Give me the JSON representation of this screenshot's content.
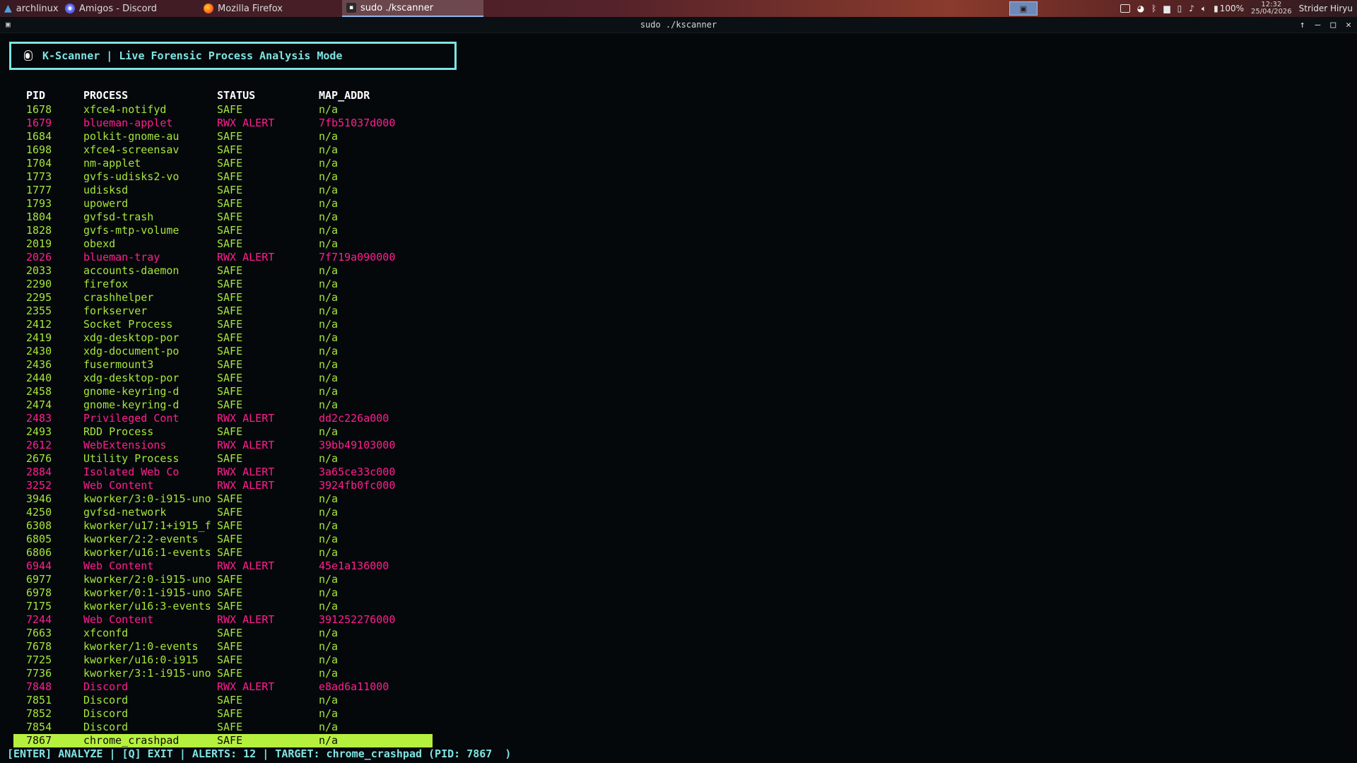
{
  "taskbar": {
    "tasks": [
      {
        "label": "archlinux",
        "icon": "arch-linux-icon"
      },
      {
        "label": "Amigos - Discord",
        "icon": "discord-icon"
      },
      {
        "label": "Mozilla Firefox",
        "icon": "firefox-icon"
      },
      {
        "label": "sudo ./kscanner",
        "icon": "terminal-icon"
      }
    ],
    "battery": "100%",
    "time": "12:32",
    "date": "25/04/2026",
    "user": "Strider Hiryu"
  },
  "window": {
    "title": "sudo ./kscanner",
    "controls": [
      "↑",
      "–",
      "□",
      "✕"
    ]
  },
  "app": {
    "header": "K-Scanner | Live Forensic Process Analysis Mode",
    "columns": {
      "pid": "PID",
      "process": "PROCESS",
      "status": "STATUS",
      "map_addr": "MAP_ADDR"
    },
    "rows": [
      {
        "pid": "1678",
        "process": "xfce4-notifyd",
        "status": "SAFE",
        "addr": "n/a"
      },
      {
        "pid": "1679",
        "process": "blueman-applet",
        "status": "RWX ALERT",
        "addr": "7fb51037d000"
      },
      {
        "pid": "1684",
        "process": "polkit-gnome-au",
        "status": "SAFE",
        "addr": "n/a"
      },
      {
        "pid": "1698",
        "process": "xfce4-screensav",
        "status": "SAFE",
        "addr": "n/a"
      },
      {
        "pid": "1704",
        "process": "nm-applet",
        "status": "SAFE",
        "addr": "n/a"
      },
      {
        "pid": "1773",
        "process": "gvfs-udisks2-vo",
        "status": "SAFE",
        "addr": "n/a"
      },
      {
        "pid": "1777",
        "process": "udisksd",
        "status": "SAFE",
        "addr": "n/a"
      },
      {
        "pid": "1793",
        "process": "upowerd",
        "status": "SAFE",
        "addr": "n/a"
      },
      {
        "pid": "1804",
        "process": "gvfsd-trash",
        "status": "SAFE",
        "addr": "n/a"
      },
      {
        "pid": "1828",
        "process": "gvfs-mtp-volume",
        "status": "SAFE",
        "addr": "n/a"
      },
      {
        "pid": "2019",
        "process": "obexd",
        "status": "SAFE",
        "addr": "n/a"
      },
      {
        "pid": "2026",
        "process": "blueman-tray",
        "status": "RWX ALERT",
        "addr": "7f719a090000"
      },
      {
        "pid": "2033",
        "process": "accounts-daemon",
        "status": "SAFE",
        "addr": "n/a"
      },
      {
        "pid": "2290",
        "process": "firefox",
        "status": "SAFE",
        "addr": "n/a"
      },
      {
        "pid": "2295",
        "process": "crashhelper",
        "status": "SAFE",
        "addr": "n/a"
      },
      {
        "pid": "2355",
        "process": "forkserver",
        "status": "SAFE",
        "addr": "n/a"
      },
      {
        "pid": "2412",
        "process": "Socket Process",
        "status": "SAFE",
        "addr": "n/a"
      },
      {
        "pid": "2419",
        "process": "xdg-desktop-por",
        "status": "SAFE",
        "addr": "n/a"
      },
      {
        "pid": "2430",
        "process": "xdg-document-po",
        "status": "SAFE",
        "addr": "n/a"
      },
      {
        "pid": "2436",
        "process": "fusermount3",
        "status": "SAFE",
        "addr": "n/a"
      },
      {
        "pid": "2440",
        "process": "xdg-desktop-por",
        "status": "SAFE",
        "addr": "n/a"
      },
      {
        "pid": "2458",
        "process": "gnome-keyring-d",
        "status": "SAFE",
        "addr": "n/a"
      },
      {
        "pid": "2474",
        "process": "gnome-keyring-d",
        "status": "SAFE",
        "addr": "n/a"
      },
      {
        "pid": "2483",
        "process": "Privileged Cont",
        "status": "RWX ALERT",
        "addr": "dd2c226a000"
      },
      {
        "pid": "2493",
        "process": "RDD Process",
        "status": "SAFE",
        "addr": "n/a"
      },
      {
        "pid": "2612",
        "process": "WebExtensions",
        "status": "RWX ALERT",
        "addr": "39bb49103000"
      },
      {
        "pid": "2676",
        "process": "Utility Process",
        "status": "SAFE",
        "addr": "n/a"
      },
      {
        "pid": "2884",
        "process": "Isolated Web Co",
        "status": "RWX ALERT",
        "addr": "3a65ce33c000"
      },
      {
        "pid": "3252",
        "process": "Web Content",
        "status": "RWX ALERT",
        "addr": "3924fb0fc000"
      },
      {
        "pid": "3946",
        "process": "kworker/3:0-i915-uno",
        "status": "SAFE",
        "addr": "n/a"
      },
      {
        "pid": "4250",
        "process": "gvfsd-network",
        "status": "SAFE",
        "addr": "n/a"
      },
      {
        "pid": "6308",
        "process": "kworker/u17:1+i915_f",
        "status": "SAFE",
        "addr": "n/a"
      },
      {
        "pid": "6805",
        "process": "kworker/2:2-events",
        "status": "SAFE",
        "addr": "n/a"
      },
      {
        "pid": "6806",
        "process": "kworker/u16:1-events",
        "status": "SAFE",
        "addr": "n/a"
      },
      {
        "pid": "6944",
        "process": "Web Content",
        "status": "RWX ALERT",
        "addr": "45e1a136000"
      },
      {
        "pid": "6977",
        "process": "kworker/2:0-i915-uno",
        "status": "SAFE",
        "addr": "n/a"
      },
      {
        "pid": "6978",
        "process": "kworker/0:1-i915-uno",
        "status": "SAFE",
        "addr": "n/a"
      },
      {
        "pid": "7175",
        "process": "kworker/u16:3-events",
        "status": "SAFE",
        "addr": "n/a"
      },
      {
        "pid": "7244",
        "process": "Web Content",
        "status": "RWX ALERT",
        "addr": "391252276000"
      },
      {
        "pid": "7663",
        "process": "xfconfd",
        "status": "SAFE",
        "addr": "n/a"
      },
      {
        "pid": "7678",
        "process": "kworker/1:0-events",
        "status": "SAFE",
        "addr": "n/a"
      },
      {
        "pid": "7725",
        "process": "kworker/u16:0-i915",
        "status": "SAFE",
        "addr": "n/a"
      },
      {
        "pid": "7736",
        "process": "kworker/3:1-i915-uno",
        "status": "SAFE",
        "addr": "n/a"
      },
      {
        "pid": "7848",
        "process": "Discord",
        "status": "RWX ALERT",
        "addr": "e8ad6a11000"
      },
      {
        "pid": "7851",
        "process": "Discord",
        "status": "SAFE",
        "addr": "n/a"
      },
      {
        "pid": "7852",
        "process": "Discord",
        "status": "SAFE",
        "addr": "n/a"
      },
      {
        "pid": "7854",
        "process": "Discord",
        "status": "SAFE",
        "addr": "n/a"
      },
      {
        "pid": "7867",
        "process": "chrome_crashpad",
        "status": "SAFE",
        "addr": "n/a",
        "selected": true
      }
    ],
    "statusbar": "[ENTER] ANALYZE | [Q] EXIT | ALERTS: 12 | TARGET: chrome_crashpad (PID: 7867  )"
  },
  "colors": {
    "safe": "#a6e63a",
    "alert": "#ff1f8e",
    "accent": "#7fe3e3",
    "selection": "#b6f03e"
  }
}
